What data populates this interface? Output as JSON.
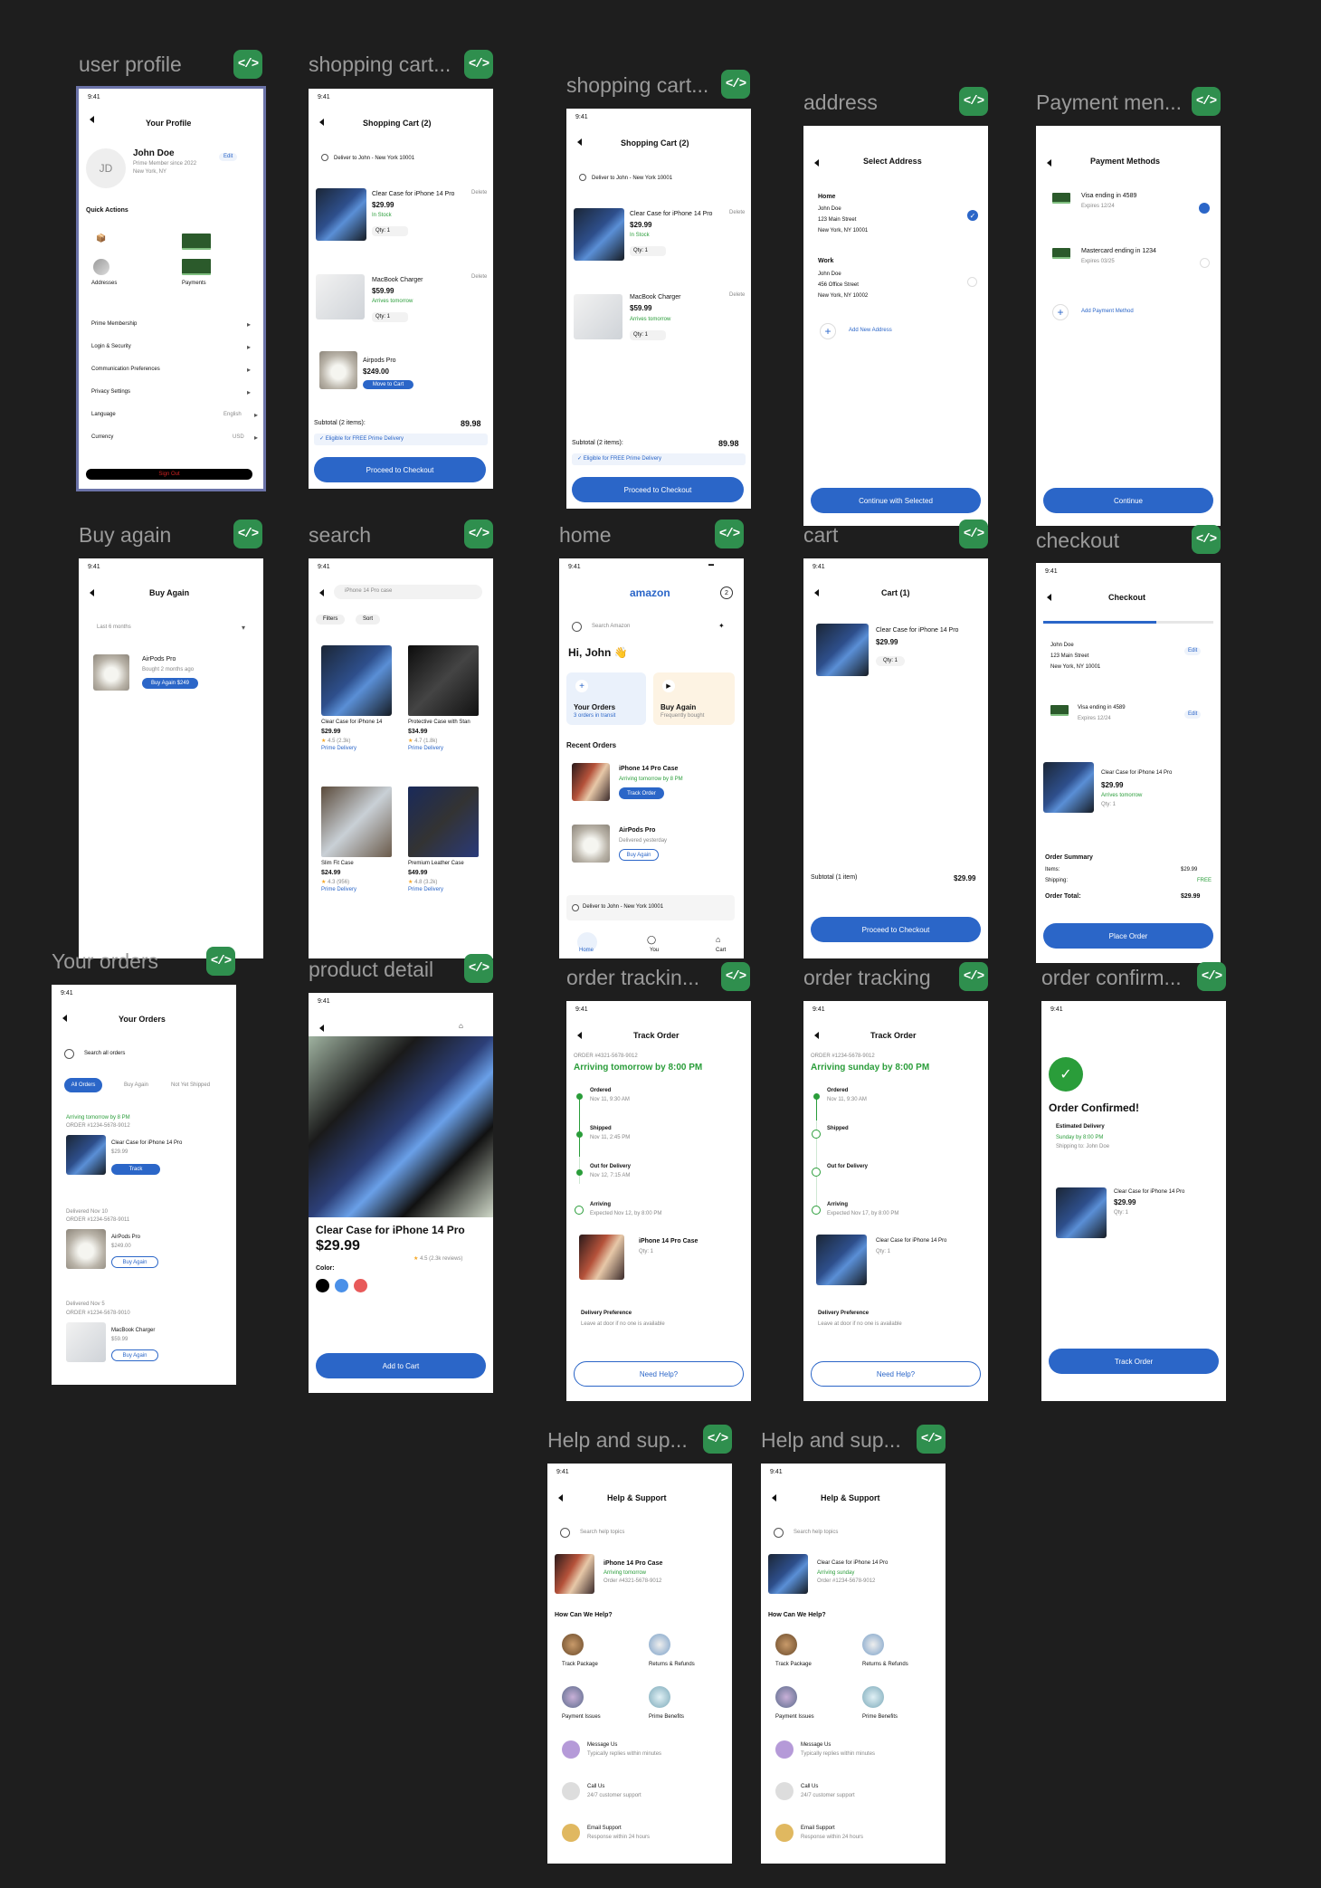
{
  "frames": {
    "profile": {
      "label": "user profile",
      "time": "9:41",
      "title": "Your Profile",
      "initials": "JD",
      "name": "John Doe",
      "edit": "Edit",
      "member": "Prime Member since 2022",
      "location": "New York, NY",
      "quick": "Quick Actions",
      "addresses": "Addresses",
      "payments": "Payments",
      "menu": [
        "Prime Membership",
        "Login & Security",
        "Communication Preferences",
        "Privacy Settings",
        "Language",
        "Currency"
      ],
      "language_val": "English",
      "currency_val": "USD",
      "signout": "Sign Out"
    },
    "cart1": {
      "label": "shopping cart...",
      "time": "9:41",
      "title": "Shopping Cart (2)",
      "deliver": "Deliver to John - New York 10001",
      "item1": "Clear Case for iPhone 14 Pro",
      "price1": "$29.99",
      "stock": "In Stock",
      "qty": "Qty: 1",
      "delete": "Delete",
      "item2": "MacBook Charger",
      "price2": "$59.99",
      "arrives": "Arrives tomorrow",
      "item3": "Airpods Pro",
      "price3": "$249.00",
      "move": "Move to Cart",
      "subtotal": "Subtotal (2 items):",
      "subtotal_val": "89.98",
      "prime": "✓ Eligible for FREE Prime Delivery",
      "checkout": "Proceed to Checkout"
    },
    "cart2": {
      "label": "shopping cart...",
      "time": "9:41",
      "title": "Shopping Cart (2)",
      "deliver": "Deliver to John - New York 10001",
      "item1": "Clear Case for iPhone 14 Pro",
      "price1": "$29.99",
      "stock": "In Stock",
      "qty": "Qty: 1",
      "delete": "Delete",
      "item2": "MacBook Charger",
      "price2": "$59.99",
      "arrives": "Arrives tomorrow",
      "subtotal": "Subtotal (2 items):",
      "subtotal_val": "89.98",
      "prime": "✓ Eligible for FREE Prime Delivery",
      "checkout": "Proceed to Checkout"
    },
    "address": {
      "label": "address",
      "time": "",
      "title": "Select Address",
      "home": "Home",
      "home_name": "John Doe",
      "home_street": "123 Main Street",
      "home_city": "New York, NY 10001",
      "work": "Work",
      "work_name": "John Doe",
      "work_street": "456 Office Street",
      "work_city": "New York, NY 10002",
      "add": "Add New Address",
      "continue": "Continue with Selected"
    },
    "payment": {
      "label": "Payment men...",
      "title": "Payment Methods",
      "visa": "Visa ending in 4589",
      "visa_exp": "Expires 12/24",
      "mc": "Mastercard ending in 1234",
      "mc_exp": "Expires 03/25",
      "add": "Add Payment Method",
      "continue": "Continue"
    },
    "buyagain": {
      "label": "Buy again",
      "time": "9:41",
      "title": "Buy Again",
      "filter": "Last 6 months",
      "item": "AirPods Pro",
      "bought": "Bought 2 months ago",
      "btn": "Buy Again $249"
    },
    "search": {
      "label": "search",
      "time": "9:41",
      "query": "iPhone 14 Pro case",
      "filters": "Filters",
      "sort": "Sort",
      "p1": "Clear Case for iPhone 14",
      "p1_price": "$29.99",
      "p1_rating": "4.5 (2.3k)",
      "p2": "Protective Case with Stan",
      "p2_price": "$34.99",
      "p2_rating": "4.7 (1.8k)",
      "p3": "Slim Fit Case",
      "p3_price": "$24.99",
      "p3_rating": "4.3 (956)",
      "p4": "Premium Leather Case",
      "p4_price": "$49.99",
      "p4_rating": "4.8 (3.2k)",
      "prime": "Prime Delivery"
    },
    "home": {
      "label": "home",
      "time": "9:41",
      "logo": "amazon",
      "cart_count": "2",
      "search": "Search Amazon",
      "greet": "Hi, John 👋",
      "orders": "Your Orders",
      "orders_sub": "3 orders in transit",
      "buy": "Buy Again",
      "buy_sub": "Frequently bought",
      "recent": "Recent Orders",
      "r1": "iPhone 14 Pro Case",
      "r1_status": "Arriving tomorrow by 8 PM",
      "r1_btn": "Track Order",
      "r2": "AirPods Pro",
      "r2_status": "Delivered yesterday",
      "r2_btn": "Buy Again",
      "deliver": "Deliver to John - New York 10001",
      "nav": [
        "Home",
        "You",
        "Cart"
      ]
    },
    "cart3": {
      "label": "cart",
      "time": "9:41",
      "title": "Cart (1)",
      "item": "Clear Case for iPhone 14 Pro",
      "price": "$29.99",
      "qty": "Qty: 1",
      "subtotal": "Subtotal (1 item)",
      "subtotal_val": "$29.99",
      "checkout": "Proceed to Checkout"
    },
    "checkout": {
      "label": "checkout",
      "time": "9:41",
      "title": "Checkout",
      "name": "John Doe",
      "street": "123 Main Street",
      "city": "New York, NY 10001",
      "edit": "Edit",
      "visa": "Visa ending in 4589",
      "visa_exp": "Expires 12/24",
      "item": "Clear Case for iPhone 14 Pro",
      "price": "$29.99",
      "arrives": "Arrives tomorrow",
      "qty": "Qty: 1",
      "summary": "Order Summary",
      "items": "Items:",
      "items_val": "$29.99",
      "ship": "Shipping:",
      "ship_val": "FREE",
      "total": "Order Total:",
      "total_val": "$29.99",
      "place": "Place Order"
    },
    "orders": {
      "label": "Your orders",
      "time": "9:41",
      "title": "Your Orders",
      "search": "Search all orders",
      "tabs": [
        "All Orders",
        "Buy Again",
        "Not Yet Shipped"
      ],
      "o1_status": "Arriving tomorrow by 8 PM",
      "o1_id": "ORDER #1234-5678-9012",
      "o1_item": "Clear Case for iPhone 14 Pro",
      "o1_price": "$29.99",
      "o1_btn": "Track",
      "o2_status": "Delivered Nov 10",
      "o2_id": "ORDER #1234-5678-9011",
      "o2_item": "AirPods Pro",
      "o2_price": "$249.00",
      "o2_btn": "Buy Again",
      "o3_status": "Delivered Nov 5",
      "o3_id": "ORDER #1234-5678-9010",
      "o3_item": "MacBook Charger",
      "o3_price": "$59.99",
      "o3_btn": "Buy Again"
    },
    "detail": {
      "label": "product detail",
      "time": "9:41",
      "name": "Clear Case for iPhone 14 Pro",
      "price": "$29.99",
      "rating": "4.5 (2.3k reviews)",
      "color": "Color:",
      "add": "Add to Cart"
    },
    "track1": {
      "label": "order trackin...",
      "time": "9:41",
      "title": "Track Order",
      "order": "ORDER #4321-5678-9012",
      "eta": "Arriving tomorrow by 8:00 PM",
      "s1": "Ordered",
      "s1_t": "Nov 11, 9:30 AM",
      "s2": "Shipped",
      "s2_t": "Nov 11, 2:45 PM",
      "s3": "Out for Delivery",
      "s3_t": "Nov 12, 7:15 AM",
      "s4": "Arriving",
      "s4_t": "Expected Nov 12, by 8:00 PM",
      "item": "iPhone 14 Pro Case",
      "qty": "Qty: 1",
      "pref": "Delivery Preference",
      "pref_val": "Leave at door if no one is available",
      "help": "Need Help?"
    },
    "track2": {
      "label": "order tracking",
      "time": "9:41",
      "title": "Track Order",
      "order": "ORDER #1234-5678-9012",
      "eta": "Arriving sunday by 8:00 PM",
      "s1": "Ordered",
      "s1_t": "Nov 11, 9:30 AM",
      "s2": "Shipped",
      "s3": "Out for Delivery",
      "s4": "Arriving",
      "s4_t": "Expected Nov 17, by 8:00 PM",
      "item": "Clear Case for iPhone 14 Pro",
      "qty": "Qty: 1",
      "pref": "Delivery Preference",
      "pref_val": "Leave at door if no one is available",
      "help": "Need Help?"
    },
    "confirm": {
      "label": "order confirm...",
      "time": "9:41",
      "title": "Order Confirmed!",
      "est": "Estimated Delivery",
      "date": "Sunday by 8:00 PM",
      "ship": "Shipping to: John Doe",
      "item": "Clear Case for iPhone 14 Pro",
      "price": "$29.99",
      "qty": "Qty: 1",
      "track": "Track Order"
    },
    "help1": {
      "label": "Help and sup...",
      "time": "9:41",
      "title": "Help & Support",
      "search": "Search help topics",
      "item": "iPhone 14 Pro Case",
      "status": "Arriving tomorrow",
      "order": "Order #4321-5678-9012",
      "how": "How Can We Help?",
      "grid": [
        "Track Package",
        "Returns & Refunds",
        "Payment Issues",
        "Prime Benefits"
      ],
      "msg": "Message Us",
      "msg_sub": "Typically replies within minutes",
      "call": "Call Us",
      "call_sub": "24/7 customer support",
      "email": "Email Support",
      "email_sub": "Response within 24 hours"
    },
    "help2": {
      "label": "Help and sup...",
      "time": "9:41",
      "title": "Help & Support",
      "search": "Search help topics",
      "item": "Clear Case for iPhone 14 Pro",
      "status": "Arriving sunday",
      "order": "Order #1234-5678-9012",
      "how": "How Can We Help?",
      "grid": [
        "Track Package",
        "Returns & Refunds",
        "Payment Issues",
        "Prime Benefits"
      ],
      "msg": "Message Us",
      "msg_sub": "Typically replies within minutes",
      "call": "Call Us",
      "call_sub": "24/7 customer support",
      "email": "Email Support",
      "email_sub": "Response within 24 hours"
    }
  },
  "colors": {
    "accent": "#2b66c8",
    "success": "#2a9d3a",
    "badge": "#2f8f4e",
    "bg": "#1e1e1e"
  }
}
